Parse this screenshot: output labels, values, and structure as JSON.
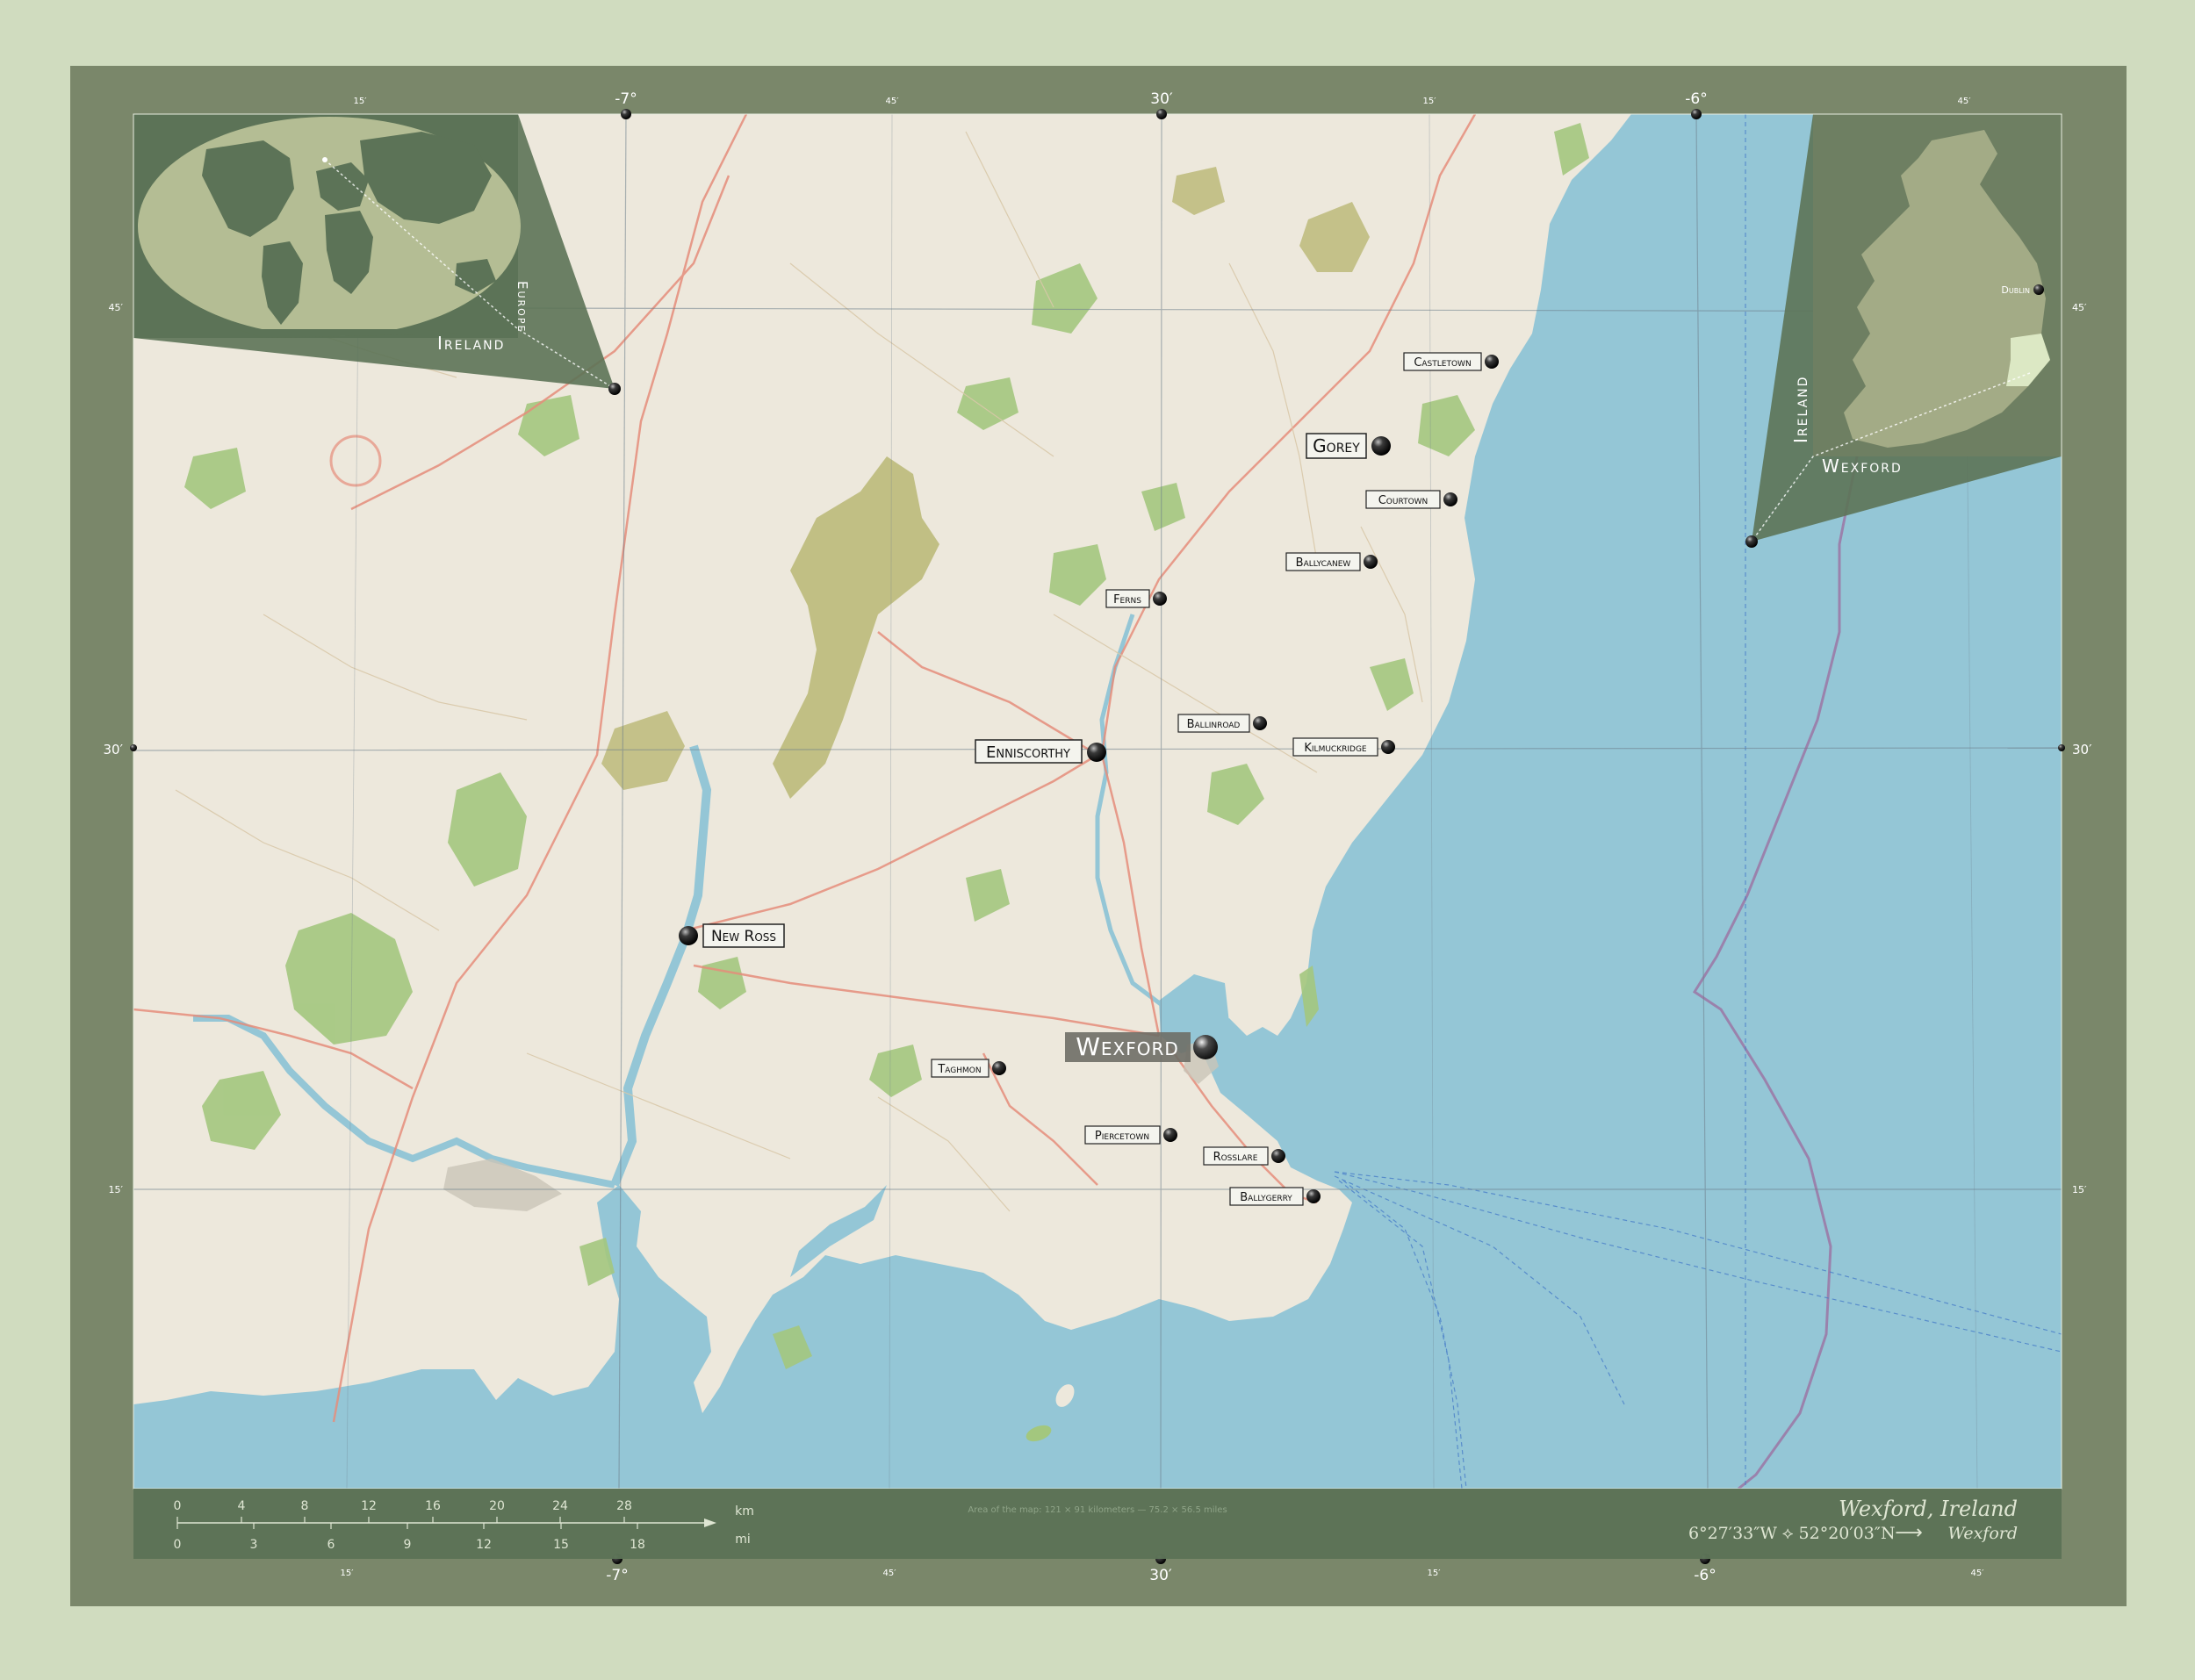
{
  "map": {
    "region": "Wexford",
    "country": "Ireland"
  },
  "title_block": {
    "title": "Wexford, Ireland",
    "coords": "6°27′33″W ⟡ 52°20′03″N",
    "arrow": "⟶",
    "target": "Wexford",
    "area_text": "Area of the map: 121 × 91 kilometers — 75.2 × 56.5 miles"
  },
  "inset_world": {
    "continent_label": "Europe",
    "country_label": "Ireland"
  },
  "inset_country": {
    "country_label": "Ireland",
    "region_label": "Wexford",
    "capital_label": "Dublin"
  },
  "grid": {
    "top_major": [
      "-7°",
      "30′",
      "-6°"
    ],
    "top_minor": [
      "15′",
      "45′",
      "15′",
      "45′"
    ],
    "bottom_major": [
      "-7°",
      "30′",
      "-6°"
    ],
    "bottom_minor": [
      "15′",
      "45′",
      "15′",
      "45′"
    ],
    "left": [
      "45′",
      "30′",
      "15′"
    ],
    "right": [
      "45′",
      "30′",
      "15′"
    ]
  },
  "scale": {
    "km_unit": "km",
    "mi_unit": "mi",
    "km_ticks": [
      "0",
      "4",
      "8",
      "12",
      "16",
      "20",
      "24",
      "28"
    ],
    "mi_ticks": [
      "0",
      "3",
      "6",
      "9",
      "12",
      "15",
      "18"
    ]
  },
  "places": {
    "wexford": "Wexford",
    "gorey": "Gorey",
    "enniscorthy": "Enniscorthy",
    "new_ross": "New Ross",
    "castletown": "Castletown",
    "courtown": "Courtown",
    "ballycanew": "Ballycanew",
    "ferns": "Ferns",
    "ballinroad": "Ballinroad",
    "kilmuckridge": "Kilmuckridge",
    "taghmon": "Taghmon",
    "piercetown": "Piercetown",
    "rosslare": "Rosslare",
    "ballygerry": "Ballygerry"
  },
  "colors": {
    "background": "#d0dcbf",
    "frame": "#7a876a",
    "panel": "#5c7357",
    "land": "#ede8dc",
    "sea": "#94c6d6",
    "forest": "#a3c77e",
    "highland": "#b9b774",
    "road": "#e58d7b"
  }
}
